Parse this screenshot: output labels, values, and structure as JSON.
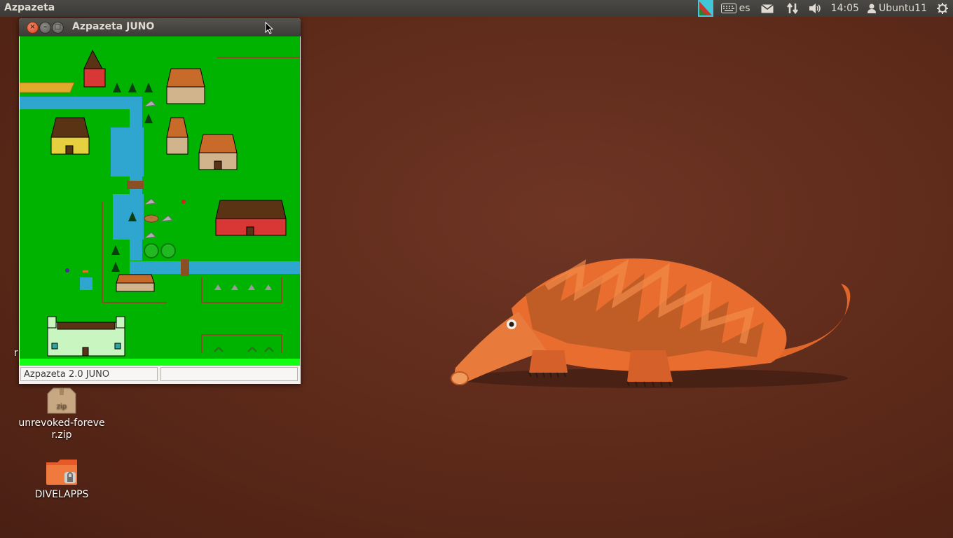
{
  "top_panel": {
    "app_name": "Azpazeta",
    "keyboard_layout": "es",
    "clock": "14:05",
    "user_name": "Ubuntu11",
    "icons": [
      "notification-flag-icon",
      "keyboard-icon",
      "mail-icon",
      "network-icon",
      "volume-icon",
      "user-icon",
      "power-gear-icon"
    ]
  },
  "window": {
    "title": "Azpazeta JUNO",
    "status_left": "Azpazeta 2.0 JUNO",
    "status_right": "",
    "colors": {
      "grass": "#00b300",
      "river": "#2ea6d0",
      "bottom_strip": "#12ff12"
    }
  },
  "desktop": {
    "partial_left_label": "r",
    "icons": [
      {
        "label": "unrevoked-forever.zip",
        "badge": "zip",
        "icon": "zip-archive-icon"
      },
      {
        "label": "DIVELAPPS",
        "icon": "locked-folder-icon"
      }
    ]
  }
}
